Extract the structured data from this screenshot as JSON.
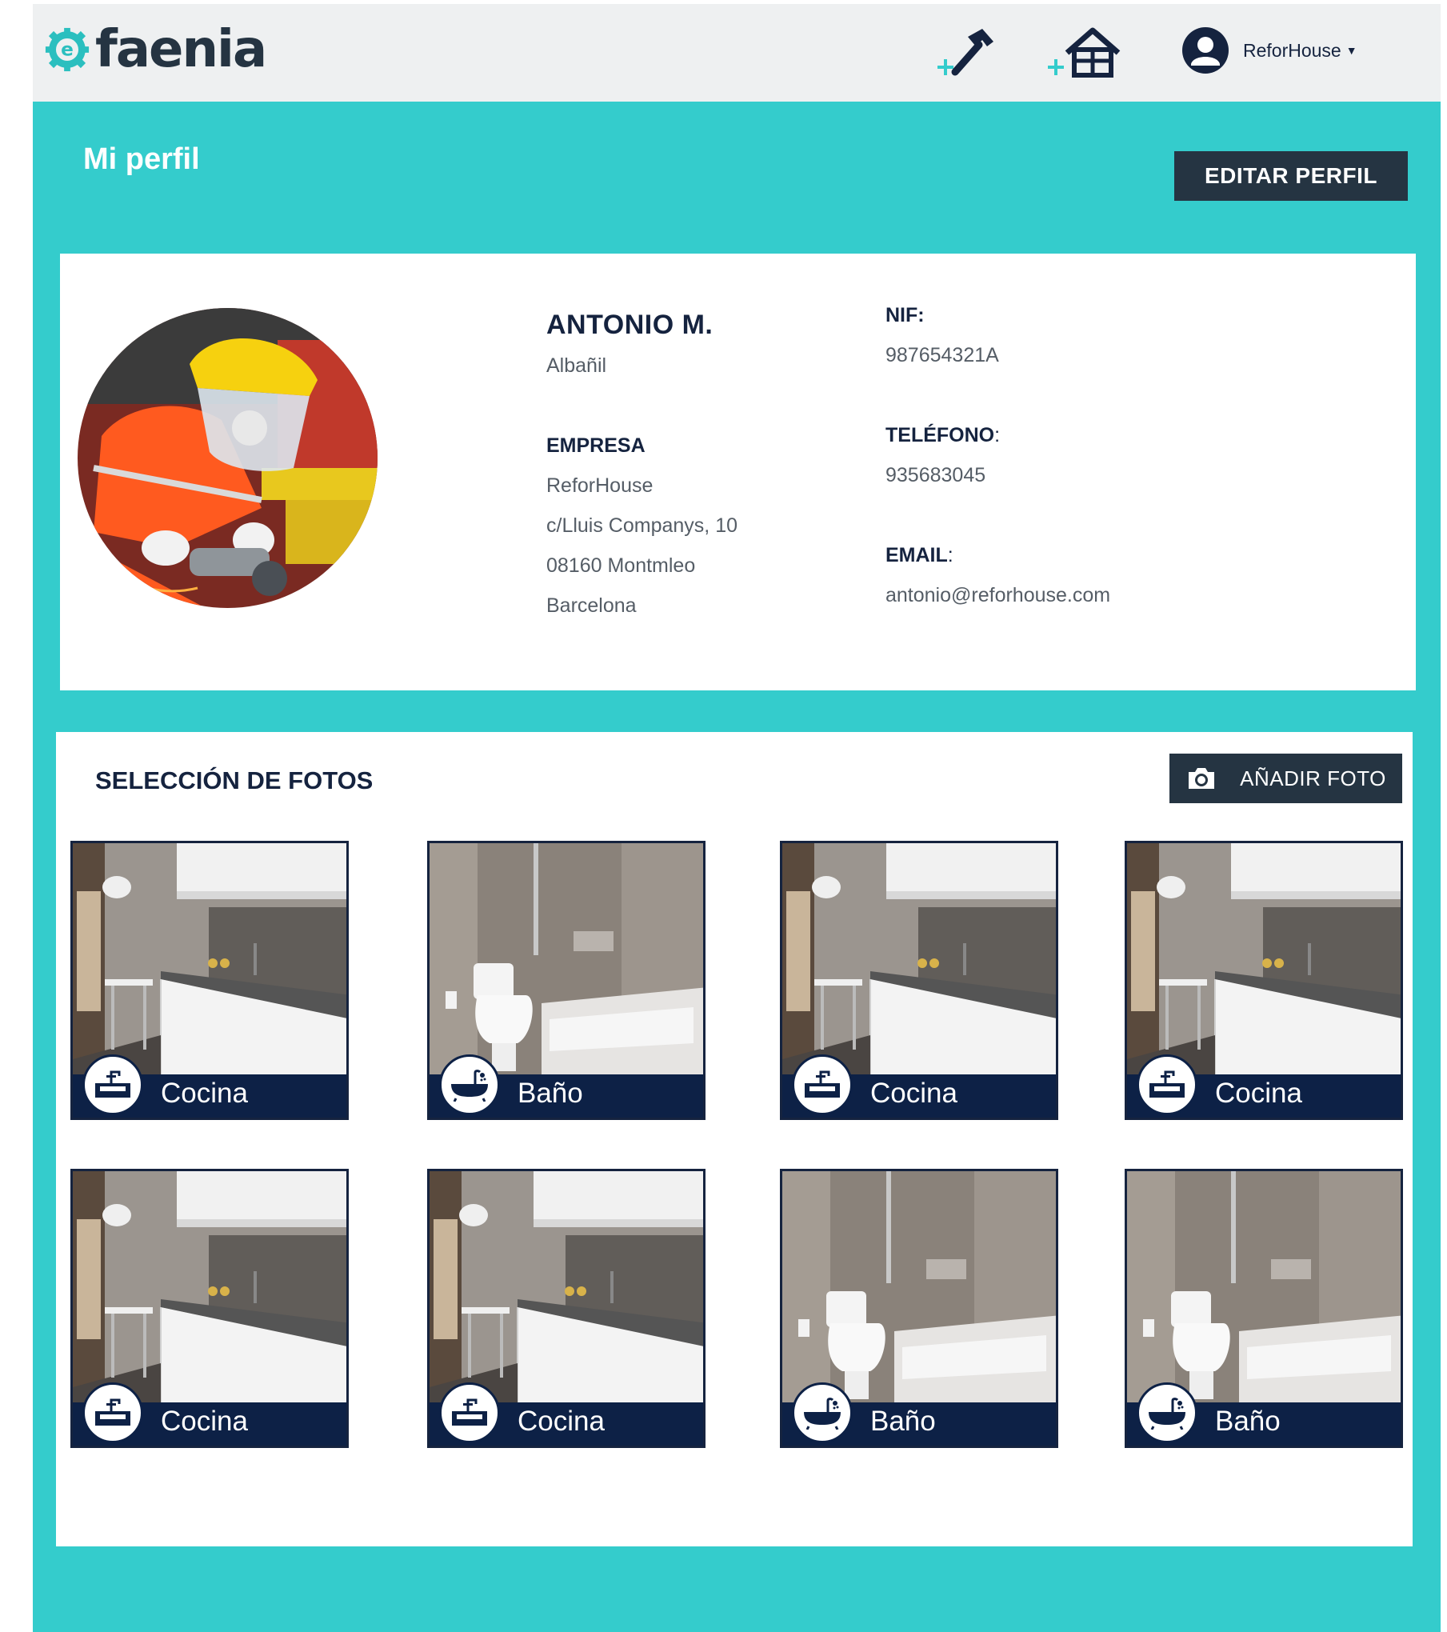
{
  "header": {
    "logo_text": "faenia",
    "user_name": "ReforHouse",
    "add_tool_icon": "add-hammer-icon",
    "add_house_icon": "add-house-icon",
    "user_icon": "user-avatar-icon"
  },
  "page": {
    "title": "Mi perfil",
    "edit_button": "EDITAR PERFIL"
  },
  "profile": {
    "name": "ANTONIO M.",
    "role": "Albañil",
    "company_label": "EMPRESA",
    "company_lines": [
      "ReforHouse",
      "c/Lluis Companys, 10",
      "08160 Montmleo",
      "Barcelona"
    ],
    "nif_label": "NIF:",
    "nif": "987654321A",
    "phone_label": "TELÉFONO",
    "phone": "935683045",
    "email_label": "EMAIL",
    "email": "antonio@reforhouse.com",
    "colon": ":"
  },
  "photos": {
    "section_title": "SELECCIÓN DE FOTOS",
    "add_button": "AÑADIR FOTO",
    "items": [
      {
        "label": "Cocina",
        "type": "kitchen"
      },
      {
        "label": "Baño",
        "type": "bath"
      },
      {
        "label": "Cocina",
        "type": "kitchen"
      },
      {
        "label": "Cocina",
        "type": "kitchen"
      },
      {
        "label": "Cocina",
        "type": "kitchen"
      },
      {
        "label": "Cocina",
        "type": "kitchen"
      },
      {
        "label": "Baño",
        "type": "bath"
      },
      {
        "label": "Baño",
        "type": "bath"
      }
    ]
  },
  "colors": {
    "teal": "#34cccc",
    "navy": "#15233f",
    "dark_button": "#253442",
    "tile_bar": "#0d2146"
  }
}
